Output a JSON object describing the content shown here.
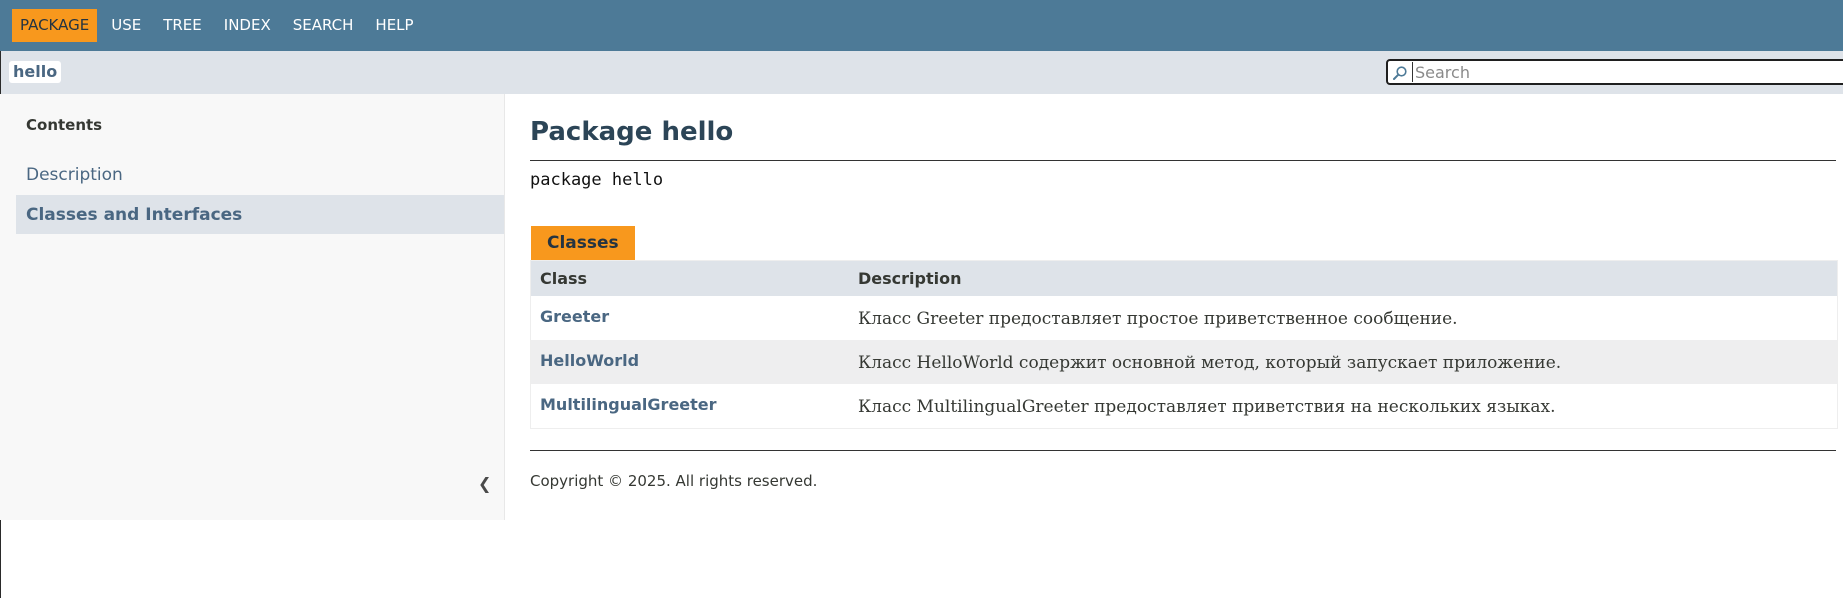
{
  "nav": {
    "items": [
      {
        "label": "PACKAGE",
        "active": true
      },
      {
        "label": "USE",
        "active": false
      },
      {
        "label": "TREE",
        "active": false
      },
      {
        "label": "INDEX",
        "active": false
      },
      {
        "label": "SEARCH",
        "active": false
      },
      {
        "label": "HELP",
        "active": false
      }
    ]
  },
  "subnav": {
    "package_label": "hello",
    "search_placeholder": "Search"
  },
  "sidebar": {
    "title": "Contents",
    "items": [
      {
        "label": "Description"
      },
      {
        "label": "Classes and Interfaces"
      }
    ],
    "collapse_glyph": "❮"
  },
  "main": {
    "title": "Package hello",
    "signature": "package hello",
    "tab_label": "Classes",
    "table": {
      "headers": [
        "Class",
        "Description"
      ],
      "rows": [
        {
          "name": "Greeter",
          "description": "Класс Greeter предоставляет простое приветственное сообщение."
        },
        {
          "name": "HelloWorld",
          "description": "Класс HelloWorld содержит основной метод, который запускает приложение."
        },
        {
          "name": "MultilingualGreeter",
          "description": "Класс MultilingualGreeter предоставляет приветствия на нескольких языках."
        }
      ]
    },
    "copyright": "Copyright © 2025. All rights reserved."
  },
  "colors": {
    "nav_bg": "#4d7a97",
    "accent": "#f8981d",
    "subnav_bg": "#dee3e9",
    "link": "#4a6782"
  }
}
